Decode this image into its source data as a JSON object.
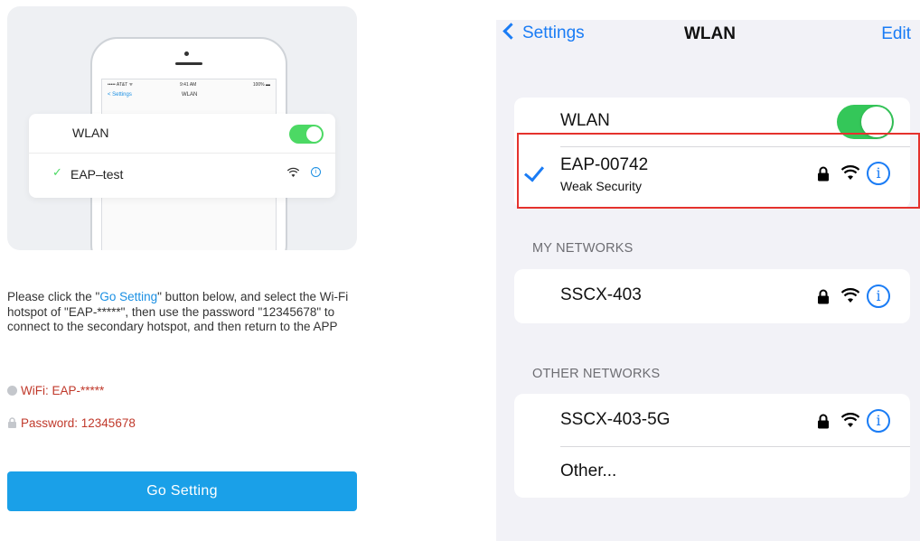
{
  "left": {
    "illustration": {
      "status_carrier": "••••• AT&T ᯤ",
      "status_time": "9:41 AM",
      "status_battery": "100% ▬",
      "nav_back": "< Settings",
      "nav_title": "WLAN",
      "wlan_label": "WLAN",
      "wlan_toggle_on": true,
      "network_check": "✓",
      "network_name": "EAP–test",
      "info_glyph": "i"
    },
    "instructions": {
      "part1": "Please click the \"",
      "highlight": "Go Setting",
      "part2": "\" button below, and select the Wi-Fi hotspot of \"EAP-*****\", then use the password \"12345678\" to connect to the secondary hotspot, and then return to the APP"
    },
    "wifi_text": "WiFi: EAP-*****",
    "password_text": "Password: 12345678",
    "go_button": "Go Setting",
    "accent_color": "#1aa0e8"
  },
  "right": {
    "nav": {
      "back_label": "Settings",
      "title": "WLAN",
      "edit_label": "Edit"
    },
    "wlan_label": "WLAN",
    "wlan_toggle_on": true,
    "connected": {
      "name": "EAP-00742",
      "subtitle": "Weak Security",
      "info_glyph": "i"
    },
    "my_networks_header": "MY NETWORKS",
    "my_networks": [
      {
        "name": "SSCX-403",
        "info_glyph": "i"
      }
    ],
    "other_networks_header": "OTHER NETWORKS",
    "other_networks": [
      {
        "name": "SSCX-403-5G",
        "info_glyph": "i"
      }
    ],
    "other_label": "Other...",
    "accent_color": "#1a7cf5",
    "highlight_color": "#e5322d"
  }
}
